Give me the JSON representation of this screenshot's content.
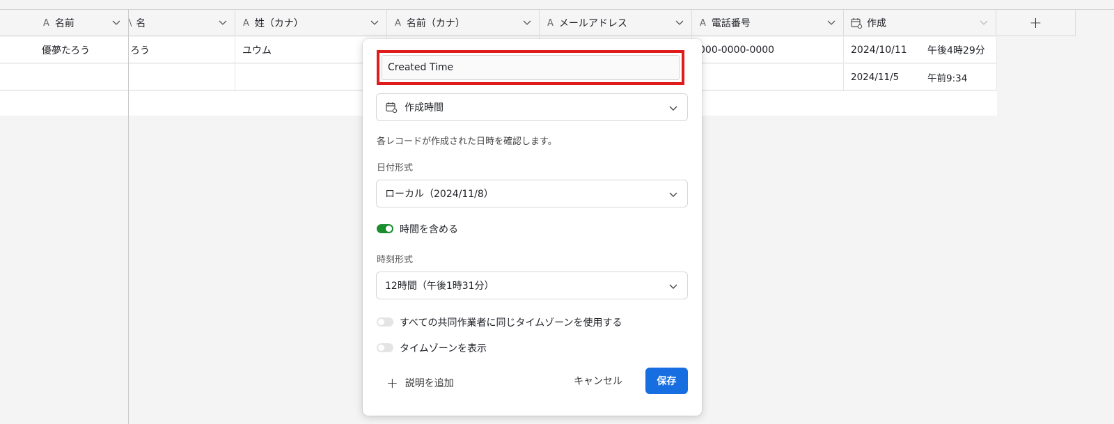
{
  "header": {
    "columns": [
      {
        "icon": "A",
        "label": "名前"
      },
      {
        "icon": "\\",
        "label": "名"
      },
      {
        "icon": "A",
        "label": "姓（カナ）"
      },
      {
        "icon": "A",
        "label": "名前（カナ）"
      },
      {
        "icon": "A",
        "label": "メールアドレス"
      },
      {
        "icon": "A",
        "label": "電話番号"
      },
      {
        "icon": "calendar-icon",
        "label": "作成"
      }
    ],
    "add_label": "+"
  },
  "rows": [
    {
      "name": "優夢たろう",
      "first": "ろう",
      "last_kana": "ユウム",
      "phone": "000-0000-0000",
      "created_date": "2024/10/11",
      "created_time": "午後4時29分"
    },
    {
      "name": "",
      "first": "",
      "last_kana": "",
      "phone": "",
      "created_date": "2024/11/5",
      "created_time": "午前9:34"
    }
  ],
  "modal": {
    "field_name": "Created Time",
    "field_type": "作成時間",
    "description": "各レコードが作成された日時を確認します。",
    "date_format_label": "日付形式",
    "date_format_value": "ローカル（2024/11/8）",
    "include_time_label": "時間を含める",
    "include_time": true,
    "time_format_label": "時刻形式",
    "time_format_value": "12時間（午後1時31分）",
    "same_timezone_label": "すべての共同作業者に同じタイムゾーンを使用する",
    "same_timezone": false,
    "show_timezone_label": "タイムゾーンを表示",
    "show_timezone": false,
    "add_description_label": "説明を追加",
    "cancel_label": "キャンセル",
    "save_label": "保存",
    "accent_color": "#166ee1",
    "toggle_on_color": "#1a8d2f",
    "highlight_color": "#e01b1b"
  }
}
